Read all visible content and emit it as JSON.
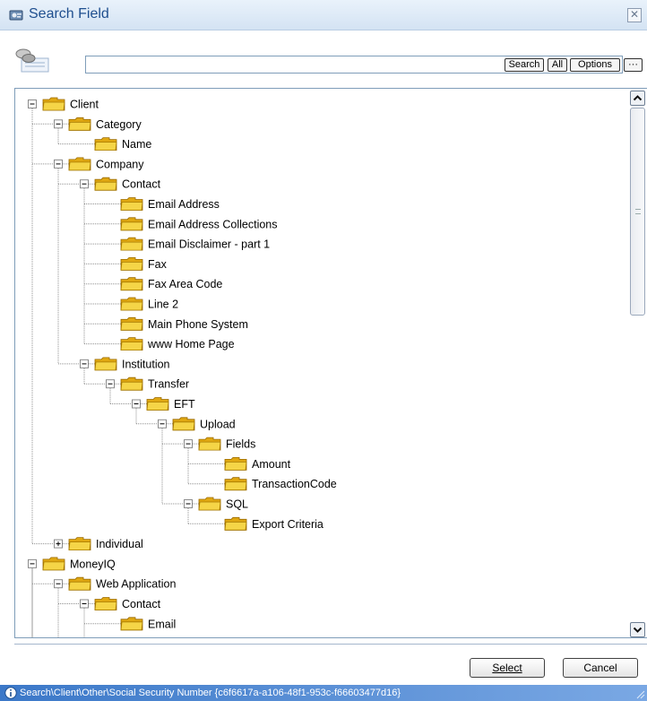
{
  "window": {
    "title": "Search Field",
    "close_glyph": "✕",
    "title_icon": "field-app-icon"
  },
  "search": {
    "value": "",
    "search_label": "Search",
    "all_label": "All",
    "options_label": "Options",
    "more_label": "···"
  },
  "tree": {
    "folder_color": "#f5d547",
    "nodes": [
      {
        "label": "Client",
        "depth": 0,
        "expander": "minus",
        "last": false
      },
      {
        "label": "Category",
        "depth": 1,
        "expander": "minus",
        "last": false
      },
      {
        "label": "Name",
        "depth": 2,
        "expander": "none",
        "last": true
      },
      {
        "label": "Company",
        "depth": 1,
        "expander": "minus",
        "last": false
      },
      {
        "label": "Contact",
        "depth": 2,
        "expander": "minus",
        "last": false
      },
      {
        "label": "Email Address",
        "depth": 3,
        "expander": "none",
        "last": false
      },
      {
        "label": "Email Address Collections",
        "depth": 3,
        "expander": "none",
        "last": false
      },
      {
        "label": "Email Disclaimer - part 1",
        "depth": 3,
        "expander": "none",
        "last": false
      },
      {
        "label": "Fax",
        "depth": 3,
        "expander": "none",
        "last": false
      },
      {
        "label": "Fax Area Code",
        "depth": 3,
        "expander": "none",
        "last": false
      },
      {
        "label": "Line 2",
        "depth": 3,
        "expander": "none",
        "last": false
      },
      {
        "label": "Main Phone System",
        "depth": 3,
        "expander": "none",
        "last": false
      },
      {
        "label": "www Home Page",
        "depth": 3,
        "expander": "none",
        "last": true
      },
      {
        "label": "Institution",
        "depth": 2,
        "expander": "minus",
        "last": true
      },
      {
        "label": "Transfer",
        "depth": 3,
        "expander": "minus",
        "last": true
      },
      {
        "label": "EFT",
        "depth": 4,
        "expander": "minus",
        "last": true
      },
      {
        "label": "Upload",
        "depth": 5,
        "expander": "minus",
        "last": true
      },
      {
        "label": "Fields",
        "depth": 6,
        "expander": "minus",
        "last": false
      },
      {
        "label": "Amount",
        "depth": 7,
        "expander": "none",
        "last": false
      },
      {
        "label": "TransactionCode",
        "depth": 7,
        "expander": "none",
        "last": true
      },
      {
        "label": "SQL",
        "depth": 6,
        "expander": "minus",
        "last": true
      },
      {
        "label": "Export Criteria",
        "depth": 7,
        "expander": "none",
        "last": true
      },
      {
        "label": "Individual",
        "depth": 1,
        "expander": "plus",
        "last": true
      },
      {
        "label": "MoneyIQ",
        "depth": 0,
        "expander": "minus",
        "last": false
      },
      {
        "label": "Web Application",
        "depth": 1,
        "expander": "minus",
        "last": false
      },
      {
        "label": "Contact",
        "depth": 2,
        "expander": "minus",
        "last": false
      },
      {
        "label": "Email",
        "depth": 3,
        "expander": "none",
        "last": false
      }
    ]
  },
  "buttons": {
    "select_label": "Select",
    "cancel_label": "Cancel"
  },
  "status": {
    "text": "Search\\Client\\Other\\Social Security Number {c6f6617a-a106-48f1-953c-f66603477d16}",
    "icon": "info-icon"
  },
  "colors": {
    "title_text": "#1f4f8f",
    "status_bar": "#3b78c8",
    "tree_line": "#909090"
  }
}
